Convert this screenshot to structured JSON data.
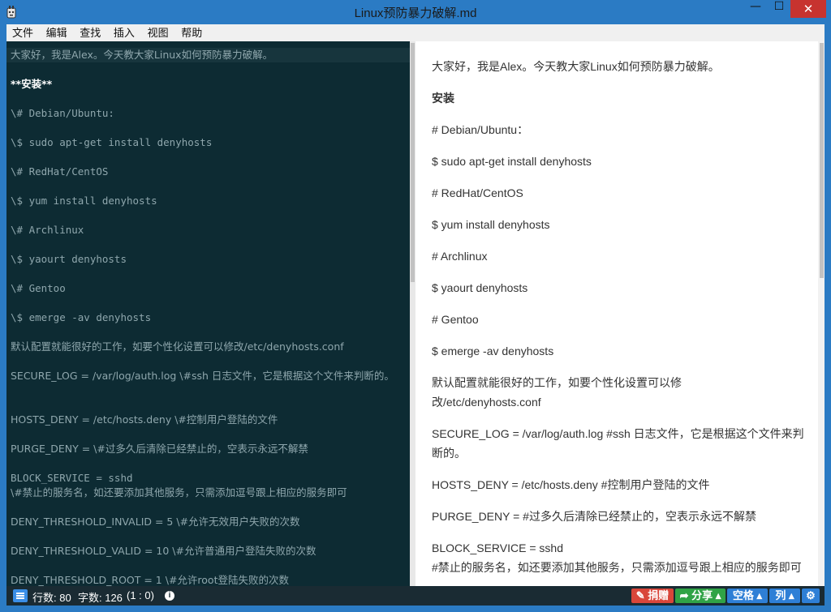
{
  "window": {
    "title": "Linux预防暴力破解.md",
    "min": "—",
    "max": "☐",
    "close": "✕"
  },
  "menu": [
    "文件",
    "编辑",
    "查找",
    "插入",
    "视图",
    "帮助"
  ],
  "editor_lines": [
    "大家好，我是Alex。今天教大家Linux如何预防暴力破解。",
    "**安装**",
    "\\# Debian/Ubuntu:",
    "\\$ sudo apt-get install denyhosts",
    "\\# RedHat/CentOS",
    "\\$ yum install denyhosts",
    "\\# Archlinux",
    "\\$ yaourt denyhosts",
    "\\# Gentoo",
    "\\$ emerge -av denyhosts",
    "默认配置就能很好的工作，如要个性化设置可以修改/etc/denyhosts.conf",
    "SECURE_LOG = /var/log/auth.log \\#ssh 日志文件，它是根据这个文件来判断的。",
    "HOSTS_DENY = /etc/hosts.deny \\#控制用户登陆的文件",
    "PURGE_DENY = \\#过多久后清除已经禁止的，空表示永远不解禁",
    "BLOCK_SERVICE = sshd",
    "\\#禁止的服务名，如还要添加其他服务，只需添加逗号跟上相应的服务即可",
    "DENY_THRESHOLD_INVALID = 5 \\#允许无效用户失败的次数",
    "DENY_THRESHOLD_VALID = 10 \\#允许普通用户登陆失败的次数",
    "DENY_THRESHOLD_ROOT = 1 \\#允许root登陆失败的次数"
  ],
  "preview_lines": [
    "大家好，我是Alex。今天教大家Linux如何预防暴力破解。",
    "安装",
    "# Debian/Ubuntu：",
    "$ sudo apt-get install denyhosts",
    "# RedHat/CentOS",
    "$ yum install denyhosts",
    "# Archlinux",
    "$ yaourt denyhosts",
    "# Gentoo",
    "$ emerge -av denyhosts",
    "默认配置就能很好的工作，如要个性化设置可以修改/etc/denyhosts.conf",
    "SECURE_LOG = /var/log/auth.log #ssh 日志文件，它是根据这个文件来判断的。",
    "HOSTS_DENY = /etc/hosts.deny #控制用户登陆的文件",
    "PURGE_DENY = #过多久后清除已经禁止的，空表示永远不解禁",
    "BLOCK_SERVICE = sshd",
    "#禁止的服务名，如还要添加其他服务，只需添加逗号跟上相应的服务即可"
  ],
  "status": {
    "lines": "行数: 80",
    "chars": "字数: 126",
    "pos": "(1 : 0)",
    "info_icon": "i",
    "donate": "捐赠",
    "share": "分享",
    "space": "空格",
    "col": "列",
    "gear": "⚙"
  }
}
